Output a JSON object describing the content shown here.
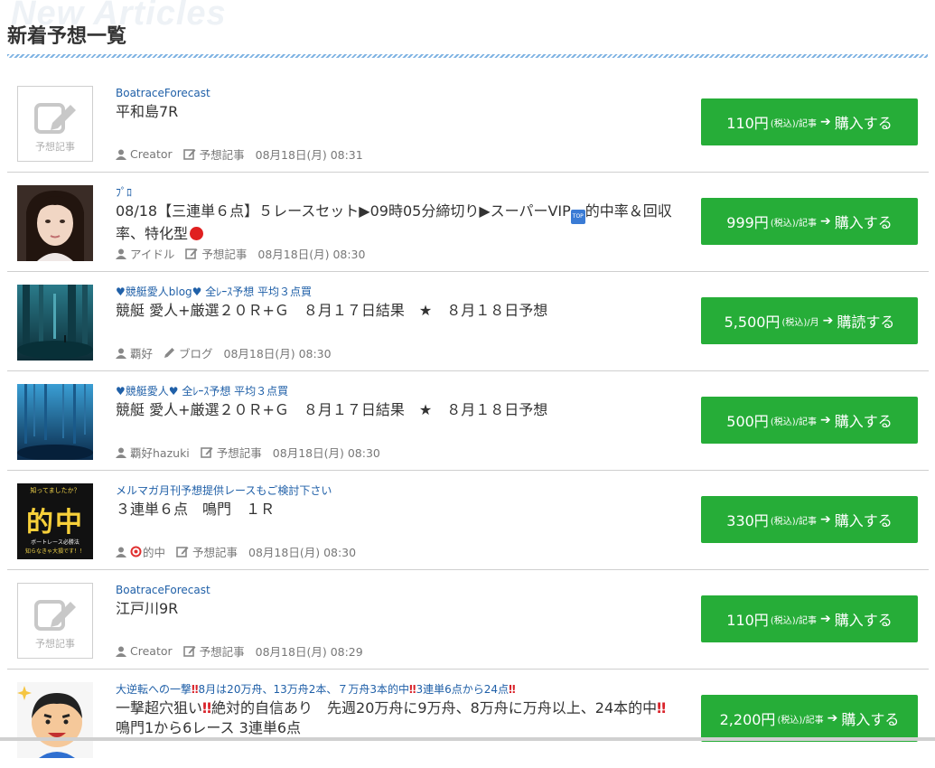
{
  "header": {
    "bg_text": "New Articles",
    "title": "新着予想一覧"
  },
  "placeholder_label": "予想記事",
  "articles": [
    {
      "thumb": "placeholder",
      "author": "BoatraceForecast",
      "title": "平和島7R",
      "user": "Creator",
      "category": "予想記事",
      "category_icon": "edit-icon",
      "date": "08月18日(月) 08:31",
      "price": "110円",
      "tax": "(税込)/記事",
      "action": "購入する"
    },
    {
      "thumb": "portrait",
      "author": "ﾌﾟﾛ",
      "title_a": "08/18【三連単６点】５レースセット▶09時05分締切り▶スーパーVIP",
      "badge": "TOP",
      "title_b": "的中率＆回収率、特化型",
      "user": "アイドル",
      "category": "予想記事",
      "category_icon": "edit-icon",
      "date": "08月18日(月) 08:30",
      "price": "999円",
      "tax": "(税込)/記事",
      "action": "購入する"
    },
    {
      "thumb": "forest",
      "author": "♥競艇愛人blog♥ 全ﾚｰｽ予想 平均３点買",
      "title": "競艇 愛人+厳選２０Ｒ+Ｇ　８月１７日結果　★　８月１８日予想",
      "user": "覇好",
      "category": "ブログ",
      "category_icon": "pencil-icon",
      "date": "08月18日(月) 08:30",
      "price": "5,500円",
      "tax": "(税込)/月",
      "action": "購読する"
    },
    {
      "thumb": "ocean",
      "author": "♥競艇愛人♥ 全ﾚｰｽ予想 平均３点買",
      "title": "競艇 愛人+厳選２０Ｒ+Ｇ　８月１７日結果　★　８月１８日予想",
      "user": "覇好hazuki",
      "category": "予想記事",
      "category_icon": "edit-icon",
      "date": "08月18日(月) 08:30",
      "price": "500円",
      "tax": "(税込)/記事",
      "action": "購入する"
    },
    {
      "thumb": "tekichu",
      "thumb_text_top": "知ってましたか？",
      "thumb_text_main": "的中",
      "thumb_text_sub1": "ボートレース必勝法",
      "thumb_text_sub2": "知らなきゃ大損です！！",
      "author": "メルマガ月刊予想提供レースもご検討下さい",
      "title": "３連単６点　鳴門　１Ｒ",
      "user": "的中",
      "category": "予想記事",
      "category_icon": "edit-icon",
      "date": "08月18日(月) 08:30",
      "price": "330円",
      "tax": "(税込)/記事",
      "action": "購入する"
    },
    {
      "thumb": "placeholder",
      "author": "BoatraceForecast",
      "title": "江戸川9R",
      "user": "Creator",
      "category": "予想記事",
      "category_icon": "edit-icon",
      "date": "08月18日(月) 08:29",
      "price": "110円",
      "tax": "(税込)/記事",
      "action": "購入する"
    },
    {
      "thumb": "cartoon",
      "author_a": "大逆転への一撃",
      "author_b": "8月は20万舟、13万舟2本、７万舟3本的中",
      "author_c": "3連単6点から24点",
      "title_a": "一撃超穴狙い",
      "title_b": "絶対的自信あり　先週20万舟に9万舟、8万舟に万舟以上、24本的中",
      "title_c": "鳴門1から6レース 3連単6点",
      "price": "2,200円",
      "tax": "(税込)/記事",
      "action": "購入する"
    }
  ]
}
